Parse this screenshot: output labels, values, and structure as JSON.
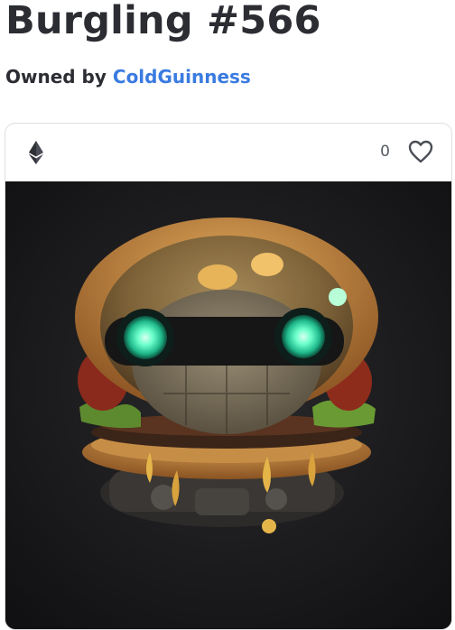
{
  "nft": {
    "title": "Burgling #566",
    "owned_by_label": "Owned by",
    "owner": "ColdGuinness"
  },
  "card": {
    "currency_icon": "ethereum-icon",
    "like_icon": "heart-icon",
    "likes_count": "0"
  },
  "colors": {
    "owner_link": "#3a7be0",
    "title_text": "#2b2d33",
    "art_background": "#1b1b1d",
    "eye_glow": "#4dffc4"
  }
}
